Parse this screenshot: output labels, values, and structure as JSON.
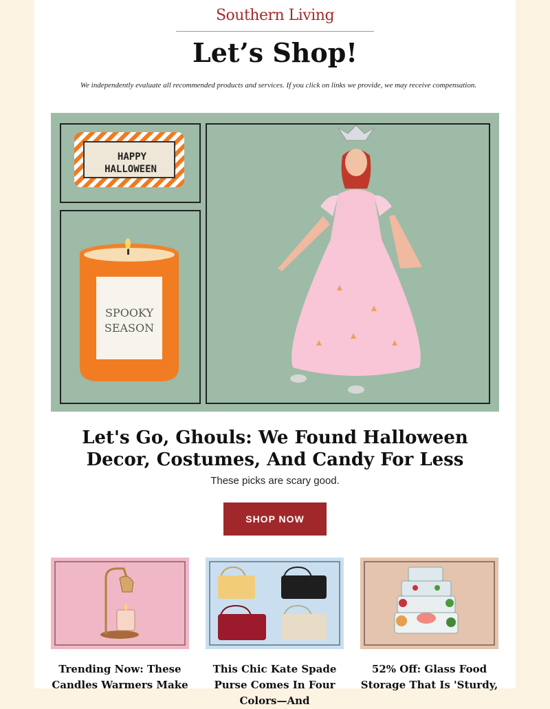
{
  "header": {
    "brand": "Southern Living",
    "title": "Let’s Shop!",
    "disclaimer": "We independently evaluate all recommended products and services. If you click on links we provide, we may receive compensation."
  },
  "hero": {
    "pillow_text_line1": "HAPPY",
    "pillow_text_line2": "HALLOWEEN",
    "candle_text_line1": "SPOOKY",
    "candle_text_line2": "SEASON"
  },
  "feature": {
    "headline": "Let's Go, Ghouls: We Found Halloween Decor, Costumes, And Candy For Less",
    "subhead": "These picks are scary good.",
    "button_label": "SHOP NOW"
  },
  "cards": [
    {
      "title": "Trending Now: These Candles Warmers Make"
    },
    {
      "title": "This Chic Kate Spade Purse Comes In Four Colors—And"
    },
    {
      "title": "52% Off: Glass Food Storage That Is 'Sturdy,"
    }
  ],
  "colors": {
    "page_bg": "#fdf3e3",
    "brand": "#a52a2a",
    "button": "#a0282a",
    "hero_bg": "#9dbba6"
  }
}
